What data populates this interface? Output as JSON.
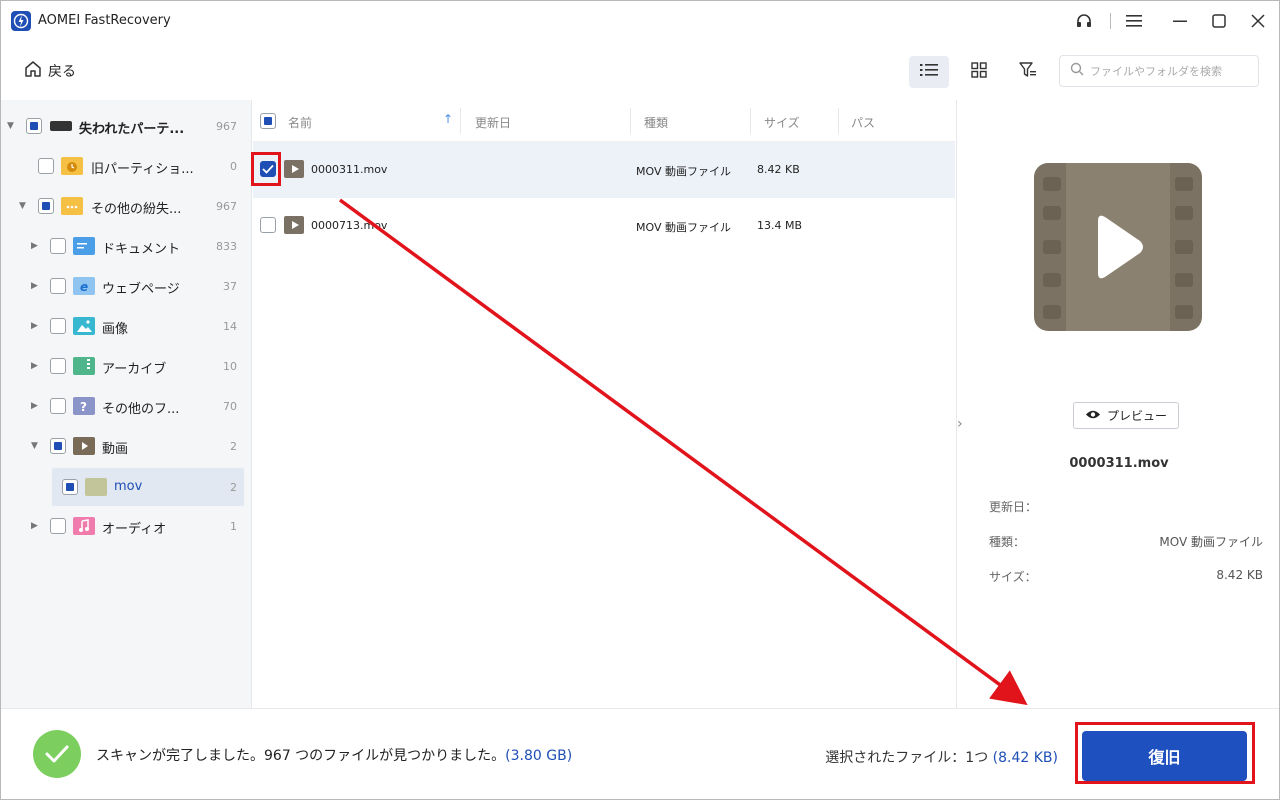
{
  "app": {
    "title": "AOMEI FastRecovery",
    "logo": "lightning-logo"
  },
  "titlebar": {
    "icons": [
      "headset-icon",
      "menu-icon",
      "minimize-icon",
      "maximize-icon",
      "close-icon"
    ]
  },
  "toolbar": {
    "back_label": "戻る",
    "search_placeholder": "ファイルやフォルダを検索",
    "view_active": "list-view"
  },
  "tree": [
    {
      "label": "失われたパーテ...",
      "count": "967",
      "checked": "partial",
      "expanded": true
    },
    {
      "label": "旧パーティショ...",
      "count": "0",
      "checked": "none"
    },
    {
      "label": "その他の紛失...",
      "count": "967",
      "checked": "partial",
      "expanded": true
    },
    {
      "label": "ドキュメント",
      "count": "833",
      "checked": "none"
    },
    {
      "label": "ウェブページ",
      "count": "37",
      "checked": "none"
    },
    {
      "label": "画像",
      "count": "14",
      "checked": "none"
    },
    {
      "label": "アーカイブ",
      "count": "10",
      "checked": "none"
    },
    {
      "label": "その他のフ...",
      "count": "70",
      "checked": "none"
    },
    {
      "label": "動画",
      "count": "2",
      "checked": "partial",
      "expanded": true
    },
    {
      "label": "mov",
      "count": "2",
      "checked": "partial",
      "selected": true
    },
    {
      "label": "オーディオ",
      "count": "1",
      "checked": "none"
    }
  ],
  "list": {
    "columns": [
      "名前",
      "更新日",
      "種類",
      "サイズ",
      "パス"
    ],
    "rows": [
      {
        "name": "0000311.mov",
        "date": "",
        "type": "MOV 動画ファイル",
        "size": "8.42 KB",
        "checked": true
      },
      {
        "name": "0000713.mov",
        "date": "",
        "type": "MOV 動画ファイル",
        "size": "13.4 MB",
        "checked": false
      }
    ]
  },
  "preview": {
    "button_label": "プレビュー",
    "file_name": "0000311.mov",
    "meta": [
      {
        "key": "更新日：",
        "value": ""
      },
      {
        "key": "種類：",
        "value": "MOV 動画ファイル"
      },
      {
        "key": "サイズ：",
        "value": "8.42 KB"
      }
    ]
  },
  "bottom": {
    "status_text": "スキャンが完了しました。967 つのファイルが見つかりました。",
    "status_size": "(3.80 GB)",
    "selected_label": "選択されたファイル：1つ",
    "selected_size": "(8.42 KB)",
    "recover_label": "復旧"
  },
  "colors": {
    "accent": "#1f4fb5",
    "success": "#7ccf5e",
    "annotation": "#e1141c"
  }
}
